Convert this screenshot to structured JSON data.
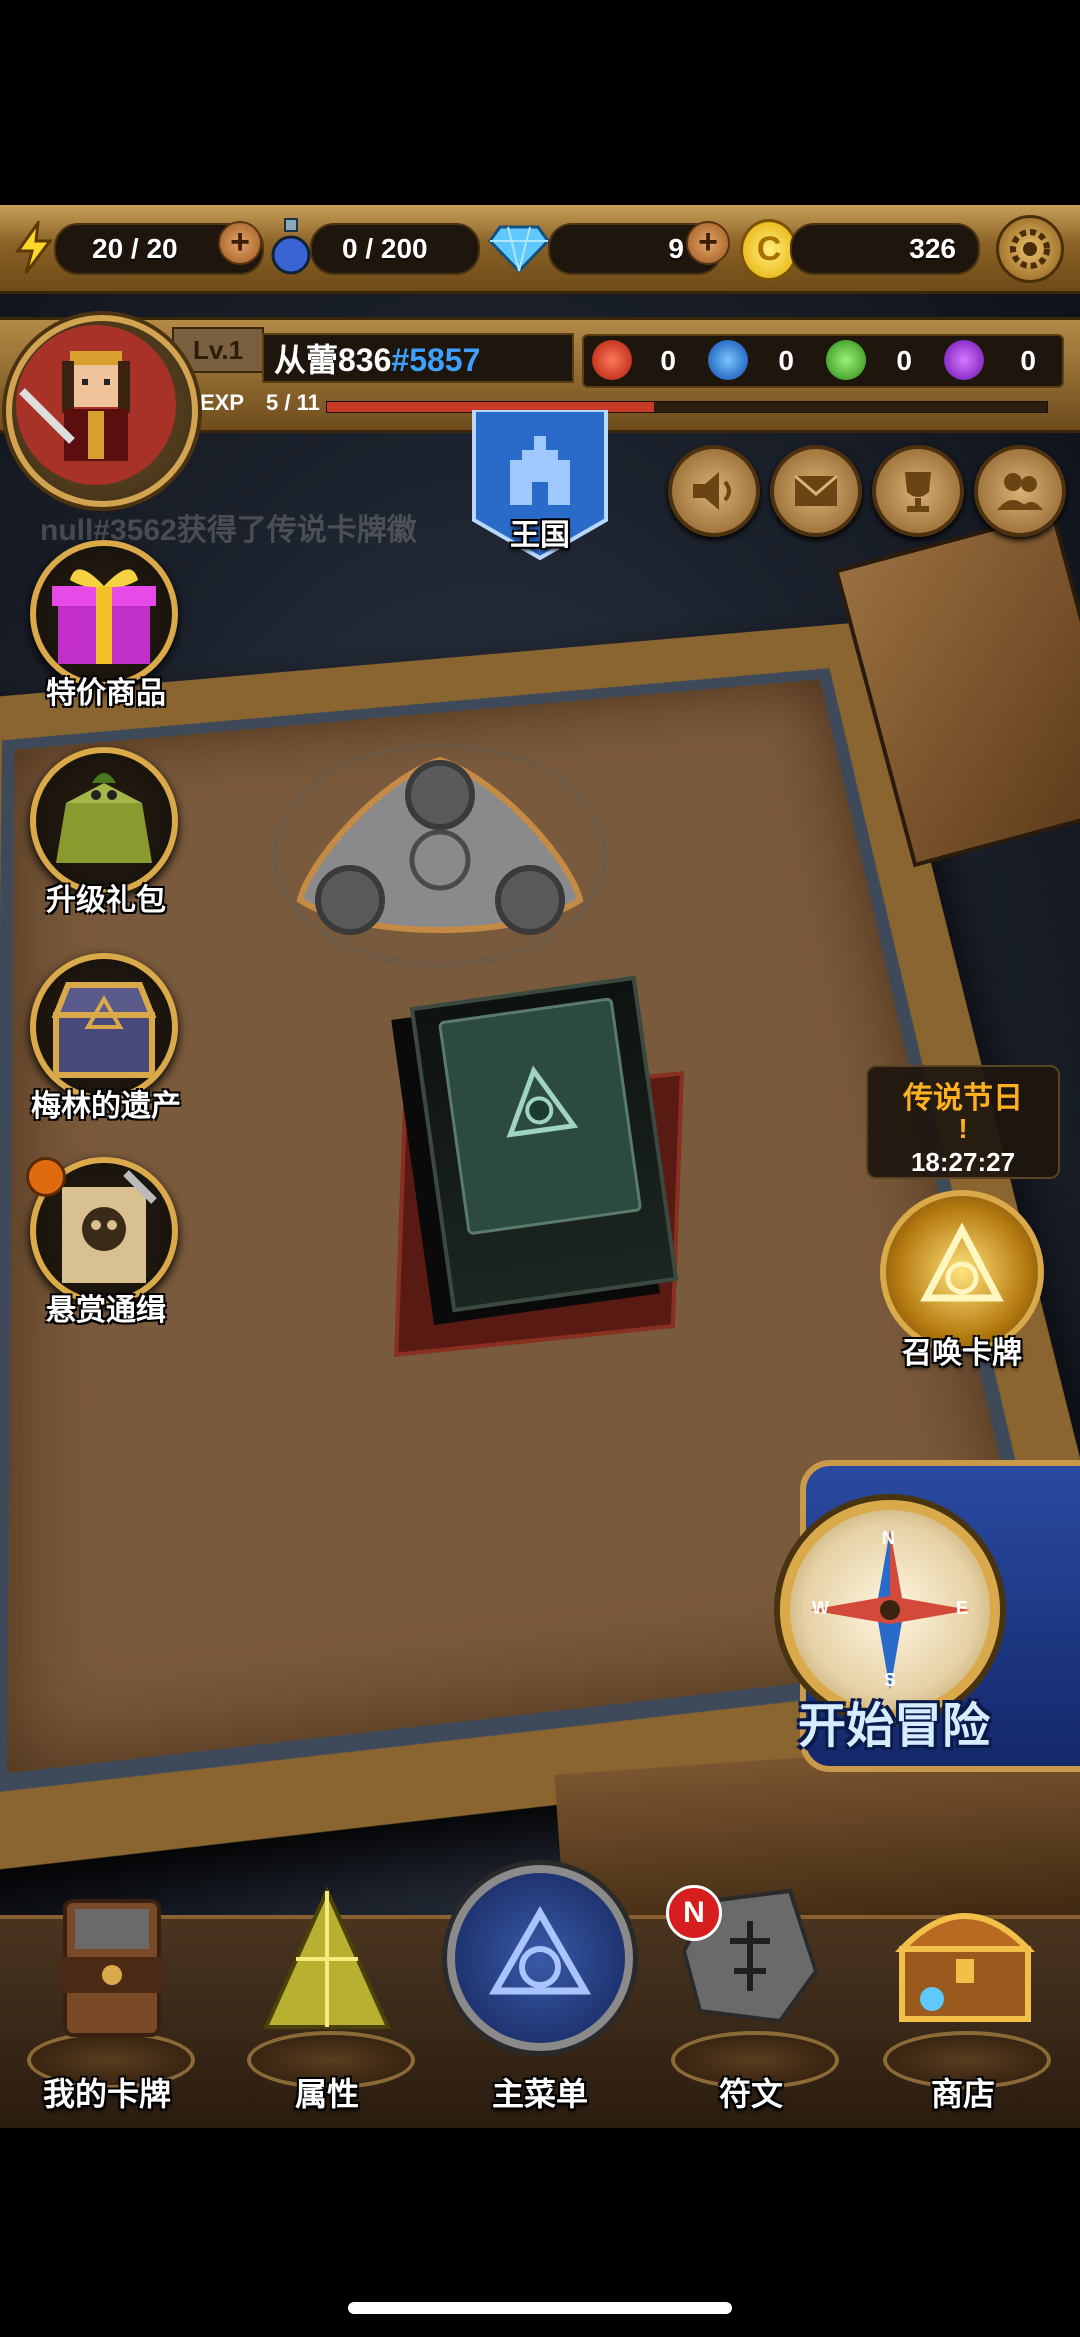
{
  "resources": {
    "energy": "20 / 20",
    "potion": "0 / 200",
    "diamonds": "9",
    "gold": "326"
  },
  "profile": {
    "level": "Lv.1",
    "name": "从蕾836",
    "tag": "#5857",
    "exp_label": "EXP",
    "exp_value": "5 / 11",
    "exp_progress": 0.4545,
    "orbs": {
      "red": "0",
      "blue": "0",
      "green": "0",
      "purple": "0"
    }
  },
  "ticker": "null#3562获得了传说卡牌徽",
  "banner_label": "王国",
  "side_menu": [
    {
      "label": "特价商品"
    },
    {
      "label": "升级礼包"
    },
    {
      "label": "梅林的遗产"
    },
    {
      "label": "悬赏通缉"
    }
  ],
  "event": {
    "title": "传说节日",
    "exclaim": "!",
    "timer": "18:27:27"
  },
  "summon_label": "召唤卡牌",
  "adventure_label": "开始冒险",
  "compass": {
    "n": "N",
    "s": "S",
    "e": "E",
    "w": "W"
  },
  "bottom_nav": [
    {
      "label": "我的卡牌"
    },
    {
      "label": "属性"
    },
    {
      "label": "主菜单"
    },
    {
      "label": "符文",
      "badge": "N"
    },
    {
      "label": "商店"
    }
  ],
  "colors": {
    "gold_frame": "#d9a94a",
    "accent_blue": "#3fa0ff",
    "exp_red": "#c73a24"
  }
}
